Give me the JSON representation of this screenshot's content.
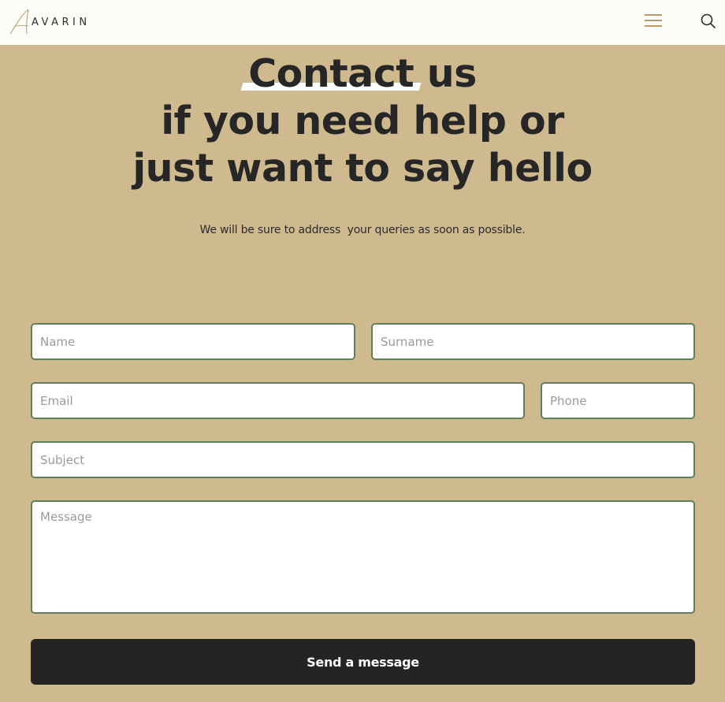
{
  "header": {
    "logo_text": "AVARIN",
    "menu_icon": "hamburger-menu-icon",
    "search_icon": "search-icon",
    "background": "#fcfcf9"
  },
  "hero": {
    "title_highlight": "Contact",
    "title_rest_line1": " us",
    "title_line2": "if you need help or",
    "title_line3": "just want to say hello",
    "subtitle": "We will be sure to address  your queries as soon as possible."
  },
  "form": {
    "name_placeholder": "Name",
    "surname_placeholder": "Surname",
    "email_placeholder": "Email",
    "phone_placeholder": "Phone",
    "subject_placeholder": "Subject",
    "message_placeholder": "Message",
    "submit_label": "Send a message"
  },
  "colors": {
    "page_background": "#cfba90",
    "field_border": "#5f7e5a",
    "button_background": "#242424",
    "accent": "#b89b67"
  }
}
